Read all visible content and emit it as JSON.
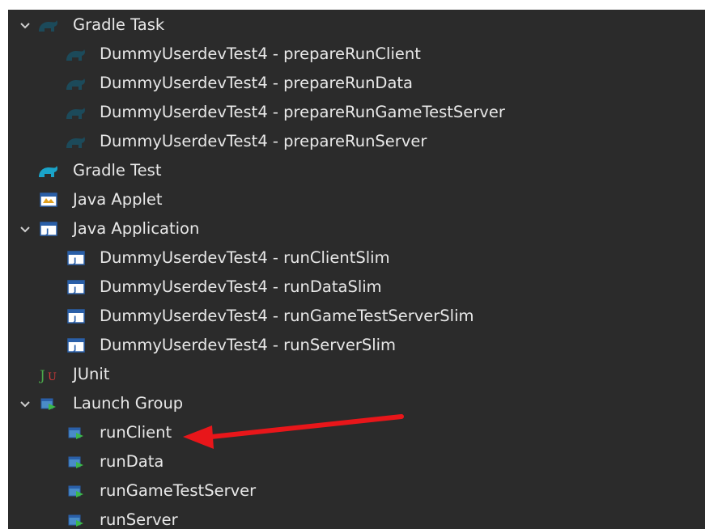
{
  "tree": {
    "gradle_task": {
      "label": "Gradle Task",
      "children": [
        "DummyUserdevTest4 - prepareRunClient",
        "DummyUserdevTest4 - prepareRunData",
        "DummyUserdevTest4 - prepareRunGameTestServer",
        "DummyUserdevTest4 - prepareRunServer"
      ]
    },
    "gradle_test": {
      "label": "Gradle Test"
    },
    "java_applet": {
      "label": "Java Applet"
    },
    "java_application": {
      "label": "Java Application",
      "children": [
        "DummyUserdevTest4 - runClientSlim",
        "DummyUserdevTest4 - runDataSlim",
        "DummyUserdevTest4 - runGameTestServerSlim",
        "DummyUserdevTest4 - runServerSlim"
      ]
    },
    "junit": {
      "label": "JUnit"
    },
    "launch_group": {
      "label": "Launch Group",
      "children": [
        "runClient",
        "runData",
        "runGameTestServer",
        "runServer"
      ]
    }
  },
  "icons": {
    "gradle_elephant": "gradle-elephant-icon",
    "java_applet": "java-applet-icon",
    "java_app": "java-application-icon",
    "junit": "junit-icon",
    "launch_group": "launch-group-icon",
    "expanded": "chevron-down-icon"
  },
  "colors": {
    "background": "#2b2b2b",
    "text": "#e8e8e8",
    "gradle": "#1c4a5a",
    "gradle_test": "#1aa3c8",
    "annotation_arrow": "#e8161a"
  }
}
